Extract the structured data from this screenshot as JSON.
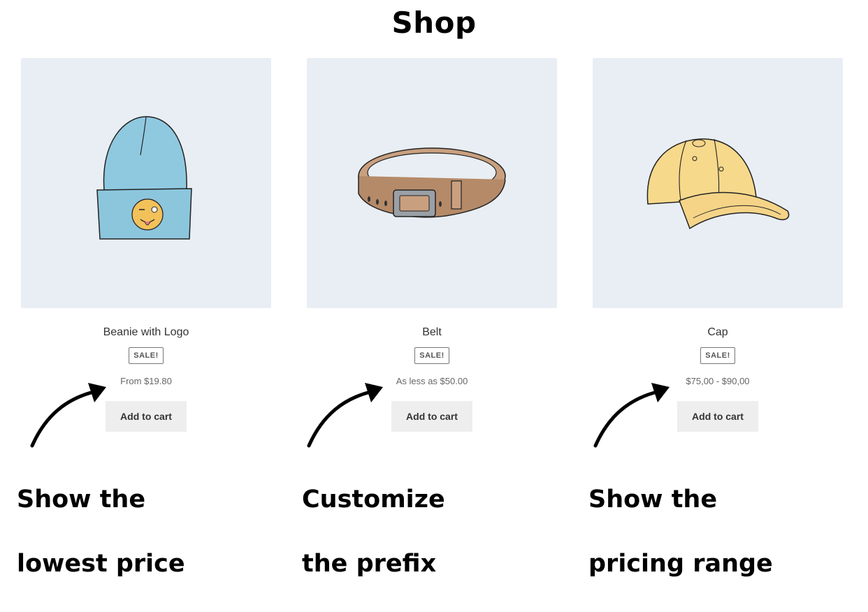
{
  "page": {
    "title": "Shop"
  },
  "products": [
    {
      "name": "Beanie with Logo",
      "badge": "SALE!",
      "price": "From $19.80",
      "button": "Add to cart"
    },
    {
      "name": "Belt",
      "badge": "SALE!",
      "price": "As less as $50.00",
      "button": "Add to cart"
    },
    {
      "name": "Cap",
      "badge": "SALE!",
      "price": "$75,00 - $90,00",
      "button": "Add to cart"
    }
  ],
  "captions": [
    {
      "line1": "Show the",
      "line2": "lowest price"
    },
    {
      "line1": "Customize",
      "line2": "the prefix"
    },
    {
      "line1": "Show the",
      "line2": "pricing range"
    }
  ]
}
